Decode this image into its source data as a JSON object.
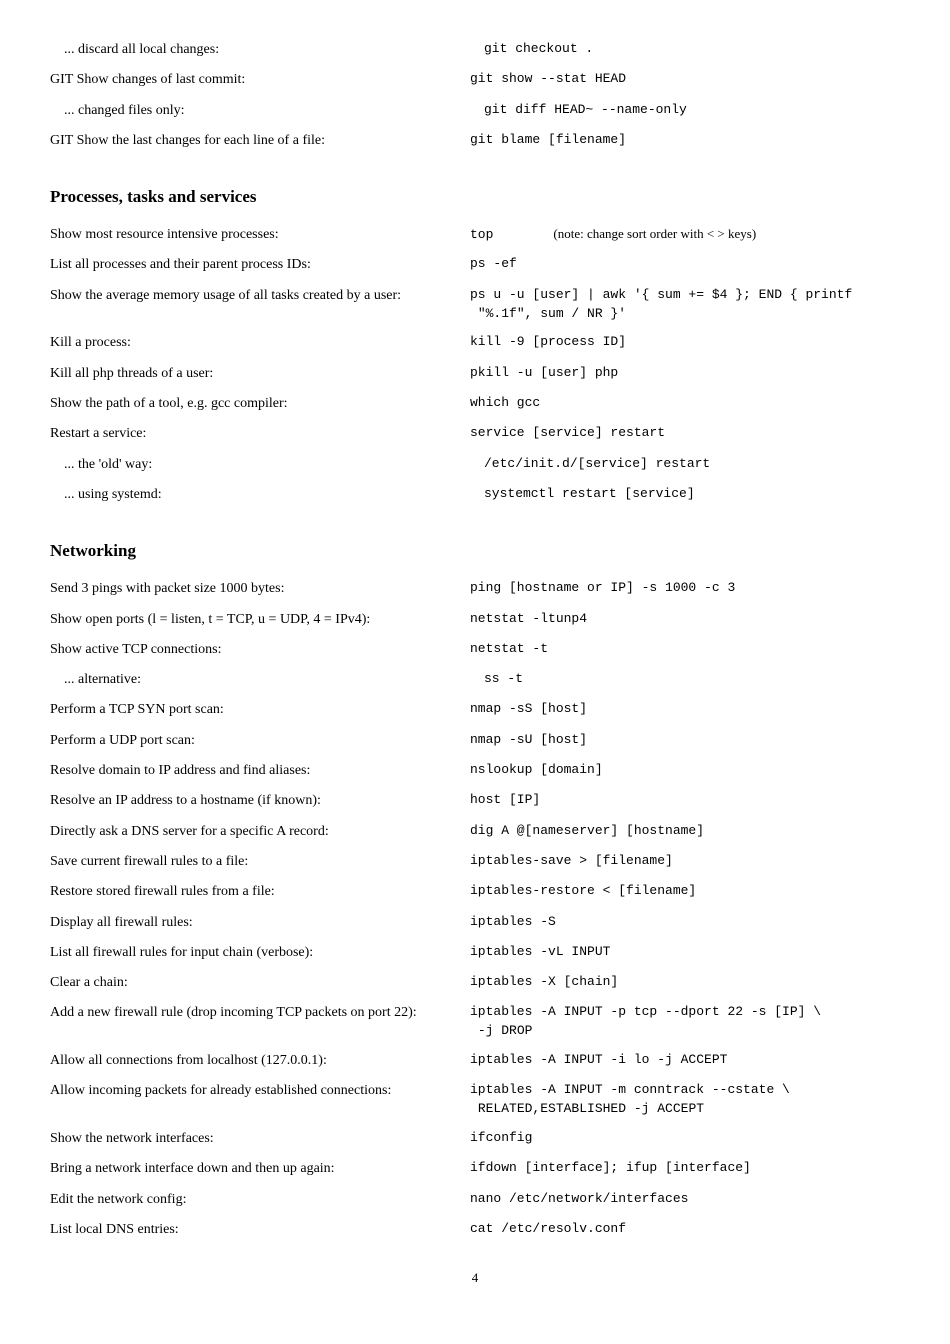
{
  "sections": {
    "git": {
      "rows": [
        {
          "sub": true,
          "desc": "... discard all local changes:",
          "cmd": "git checkout ."
        },
        {
          "desc": "GIT Show changes of last commit:",
          "cmd": "git show --stat HEAD"
        },
        {
          "sub": true,
          "desc": "... changed files only:",
          "cmd": "git diff HEAD~ --name-only"
        },
        {
          "desc": "GIT Show the last changes for each line of a file:",
          "cmd": "git blame [filename]"
        }
      ]
    },
    "processes": {
      "title": "Processes, tasks and services",
      "rows": [
        {
          "desc": "Show most resource intensive processes:",
          "cmd": "top",
          "note": "(note: change sort order with < > keys)"
        },
        {
          "desc": "List all processes and their parent process IDs:",
          "cmd": "ps -ef"
        },
        {
          "desc": "Show the average memory usage of all tasks created by a user:",
          "cmd": "ps u -u [user] | awk '{ sum += $4 }; END { printf\n \"%.1f\", sum / NR }'"
        },
        {
          "desc": "Kill a process:",
          "cmd": "kill -9 [process ID]"
        },
        {
          "desc": "Kill all php threads of a user:",
          "cmd": "pkill -u [user] php"
        },
        {
          "desc": "Show the path of a tool, e.g. gcc compiler:",
          "cmd": "which gcc"
        },
        {
          "desc": "Restart a service:",
          "cmd": "service [service] restart"
        },
        {
          "sub": true,
          "desc": "... the 'old' way:",
          "cmd": "/etc/init.d/[service] restart"
        },
        {
          "sub": true,
          "desc": "... using systemd:",
          "cmd": "systemctl restart [service]"
        }
      ]
    },
    "networking": {
      "title": "Networking",
      "rows": [
        {
          "desc": "Send 3 pings with packet size 1000 bytes:",
          "cmd": "ping [hostname or IP] -s 1000 -c 3"
        },
        {
          "desc": "Show open ports (l = listen, t = TCP, u = UDP, 4 = IPv4):",
          "cmd": "netstat -ltunp4"
        },
        {
          "desc": "Show active TCP connections:",
          "cmd": "netstat -t"
        },
        {
          "sub": true,
          "desc": "... alternative:",
          "cmd": "ss -t"
        },
        {
          "desc": "Perform a TCP SYN port scan:",
          "cmd": "nmap -sS [host]"
        },
        {
          "desc": "Perform a UDP port scan:",
          "cmd": "nmap -sU [host]"
        },
        {
          "desc": "Resolve domain to IP address and find aliases:",
          "cmd": "nslookup [domain]"
        },
        {
          "desc": "Resolve an IP address to a hostname (if known):",
          "cmd": "host [IP]"
        },
        {
          "desc": "Directly ask a DNS server for a specific A record:",
          "cmd": "dig A @[nameserver] [hostname]"
        },
        {
          "desc": "Save current firewall rules to a file:",
          "cmd": "iptables-save > [filename]"
        },
        {
          "desc": "Restore stored firewall rules from a file:",
          "cmd": "iptables-restore < [filename]"
        },
        {
          "desc": "Display all firewall rules:",
          "cmd": "iptables -S"
        },
        {
          "desc": "List all firewall rules for input chain (verbose):",
          "cmd": "iptables -vL INPUT"
        },
        {
          "desc": "Clear a chain:",
          "cmd": "iptables -X [chain]"
        },
        {
          "desc": "Add a new firewall rule (drop incoming TCP packets on port 22):",
          "cmd": "iptables -A INPUT -p tcp --dport 22 -s [IP] \\\n -j DROP"
        },
        {
          "desc": "Allow all connections from localhost (127.0.0.1):",
          "cmd": "iptables -A INPUT -i lo -j ACCEPT"
        },
        {
          "desc": "Allow incoming packets for already established connections:",
          "cmd": "iptables -A INPUT -m conntrack --cstate \\\n RELATED,ESTABLISHED -j ACCEPT"
        },
        {
          "desc": "Show the network interfaces:",
          "cmd": "ifconfig"
        },
        {
          "desc": "Bring a network interface down and then up again:",
          "cmd": "ifdown [interface]; ifup [interface]"
        },
        {
          "desc": "Edit the network config:",
          "cmd": "nano /etc/network/interfaces"
        },
        {
          "desc": "List local DNS entries:",
          "cmd": "cat /etc/resolv.conf"
        }
      ]
    }
  },
  "pagenum": "4"
}
